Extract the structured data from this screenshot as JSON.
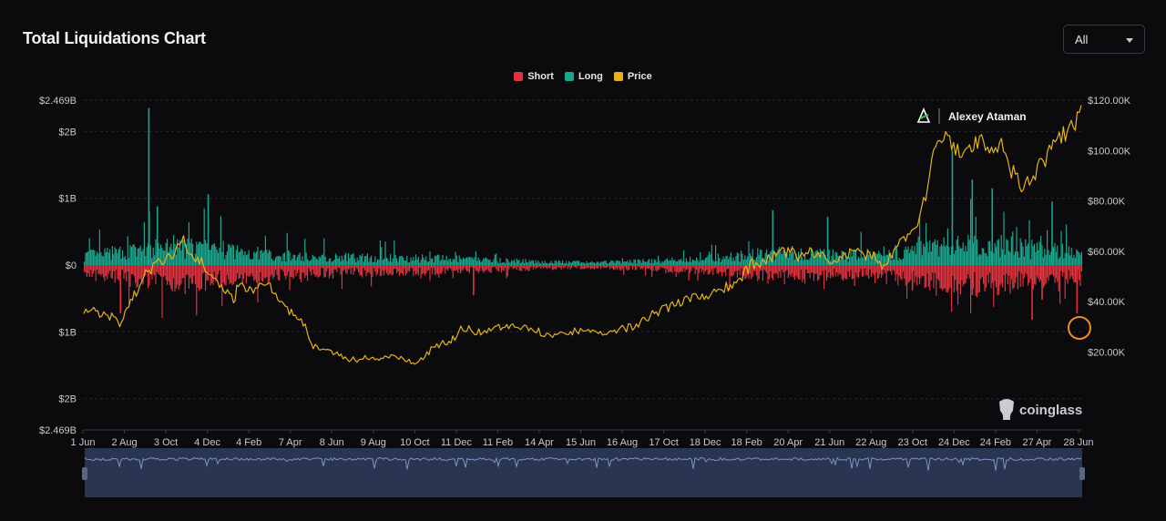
{
  "header": {
    "title": "Total Liquidations Chart"
  },
  "range_select": {
    "value": "All"
  },
  "watermark": {
    "author": "Alexey Ataman",
    "brand": "coinglass"
  },
  "colors": {
    "short": "#e0323f",
    "long": "#1aa68d",
    "price": "#e5b21e",
    "background": "#0b0b0e",
    "navigator": "#2a3552"
  },
  "chart_data": {
    "type": "bar",
    "legend": [
      {
        "name": "Short",
        "color": "#e0323f"
      },
      {
        "name": "Long",
        "color": "#1aa68d"
      },
      {
        "name": "Price",
        "color": "#e5b21e"
      }
    ],
    "x_ticks": [
      "1 Jun",
      "2 Aug",
      "3 Oct",
      "4 Dec",
      "4 Feb",
      "7 Apr",
      "8 Jun",
      "9 Aug",
      "10 Oct",
      "11 Dec",
      "11 Feb",
      "14 Apr",
      "15 Jun",
      "16 Aug",
      "17 Oct",
      "18 Dec",
      "18 Feb",
      "20 Apr",
      "21 Jun",
      "22 Aug",
      "23 Oct",
      "24 Dec",
      "24 Feb",
      "27 Apr",
      "28 Jun"
    ],
    "left_axis": {
      "ticks": [
        "$2.469B",
        "$2B",
        "$1B",
        "$0",
        "$1B",
        "$2B",
        "$2.469B"
      ],
      "values": [
        2.469,
        2,
        1,
        0,
        -1,
        -2,
        -2.469
      ]
    },
    "right_axis": {
      "ticks": [
        "$120.00K",
        "$100.00K",
        "$80.00K",
        "$60.00K",
        "$40.00K",
        "$20.00K"
      ],
      "values": [
        120,
        100,
        80,
        60,
        40,
        20
      ]
    },
    "price_series": {
      "name": "Price",
      "unit": "K USD",
      "x": [
        0,
        0.03,
        0.036,
        0.045,
        0.06,
        0.075,
        0.09,
        0.1,
        0.11,
        0.12,
        0.13,
        0.14,
        0.15,
        0.155,
        0.17,
        0.185,
        0.2,
        0.22,
        0.23,
        0.25,
        0.26,
        0.27,
        0.3,
        0.31,
        0.33,
        0.34,
        0.35,
        0.37,
        0.38,
        0.4,
        0.42,
        0.45,
        0.47,
        0.48,
        0.5,
        0.52,
        0.53,
        0.55,
        0.57,
        0.6,
        0.63,
        0.65,
        0.66,
        0.67,
        0.69,
        0.7,
        0.72,
        0.73,
        0.75,
        0.77,
        0.79,
        0.8,
        0.82,
        0.84,
        0.85,
        0.86,
        0.88,
        0.9,
        0.91,
        0.92,
        0.93,
        0.94,
        0.95,
        0.96,
        0.97,
        0.98,
        0.99,
        1.0
      ],
      "y": [
        37,
        34,
        30,
        38,
        50,
        55,
        60,
        64,
        58,
        55,
        50,
        45,
        40,
        47,
        44,
        48,
        38,
        32,
        22,
        20,
        18,
        17,
        18,
        18,
        16,
        17,
        22,
        25,
        30,
        27,
        30,
        29,
        26,
        27,
        29,
        27,
        28,
        30,
        35,
        40,
        43,
        47,
        50,
        55,
        57,
        60,
        58,
        60,
        57,
        60,
        58,
        55,
        63,
        75,
        95,
        105,
        99,
        105,
        98,
        102,
        92,
        85,
        88,
        95,
        100,
        106,
        108,
        118
      ]
    },
    "long_spikes": [
      {
        "x": 0.0645,
        "value": 2.35
      },
      {
        "x": 0.073,
        "value": 0.88
      },
      {
        "x": 0.124,
        "value": 1.06
      },
      {
        "x": 0.69,
        "value": 0.82
      },
      {
        "x": 0.745,
        "value": 0.72
      },
      {
        "x": 0.87,
        "value": 1.72
      },
      {
        "x": 0.89,
        "value": 1.28
      },
      {
        "x": 0.91,
        "value": 1.15
      },
      {
        "x": 0.97,
        "value": 0.95
      }
    ],
    "short_spikes": [
      {
        "x": 0.036,
        "value": -0.72
      },
      {
        "x": 0.39,
        "value": -0.45
      },
      {
        "x": 0.83,
        "value": -0.38
      },
      {
        "x": 0.89,
        "value": -0.45
      },
      {
        "x": 0.96,
        "value": -0.52
      },
      {
        "x": 0.95,
        "value": -0.82
      },
      {
        "x": 0.995,
        "value": -0.72
      }
    ]
  }
}
